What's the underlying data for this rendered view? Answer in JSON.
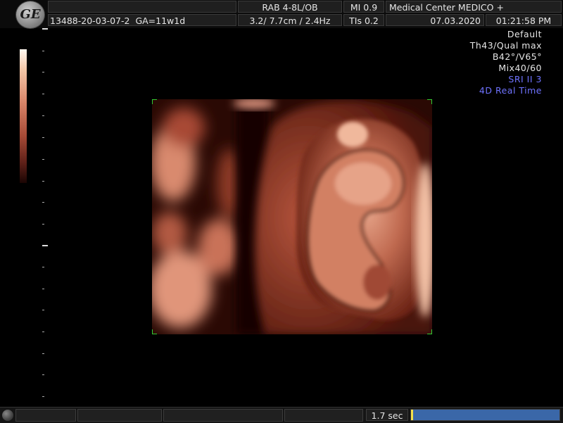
{
  "header": {
    "logo": "GE",
    "probe": "RAB 4-8L/OB",
    "mi": "MI  0.9",
    "institution": "Medical Center MEDICO +",
    "patient_id": "13488-20-03-07-2",
    "ga": "GA=11w1d",
    "depth_freq": "3.2/ 7.7cm / 2.4Hz",
    "tis": "TIs  0.2",
    "date": "07.03.2020",
    "time": "01:21:58 PM"
  },
  "params": {
    "lines": [
      "Default",
      "Th43/Qual max",
      "B42°/V65°",
      "Mix40/60"
    ],
    "blue_lines": [
      "SRI II 3",
      "4D Real Time"
    ]
  },
  "footer": {
    "cine_label": "1.7 sec",
    "cine_progress": 1.0
  },
  "colors": {
    "accent_blue": "#6f73ff",
    "cine_blue": "#3a67a8",
    "cine_marker": "#f4e04a",
    "roi_corner": "#33cc33"
  },
  "icons": [
    "ge-logo-icon",
    "trackball-knob-icon"
  ]
}
